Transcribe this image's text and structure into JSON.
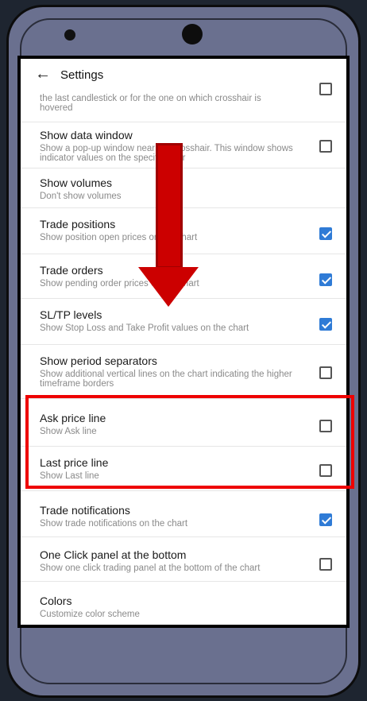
{
  "header": {
    "title": "Settings"
  },
  "colors": {
    "accent": "#2f7bd6",
    "arrow": "#cc0000",
    "highlight": "#ee0000"
  },
  "rows": [
    {
      "title": "",
      "subtitle": "the last candlestick or for the one on which crosshair is hovered",
      "checked": false
    },
    {
      "title": "Show data window",
      "subtitle": "Show a pop-up window near the crosshair. This window shows indicator values on the specified bar",
      "checked": false
    },
    {
      "title": "Show volumes",
      "subtitle": "Don't show volumes",
      "checked": null
    },
    {
      "title": "Trade positions",
      "subtitle": "Show position open prices on the chart",
      "checked": true
    },
    {
      "title": "Trade orders",
      "subtitle": "Show pending order prices on the chart",
      "checked": true
    },
    {
      "title": "SL/TP levels",
      "subtitle": "Show Stop Loss and Take Profit values on the chart",
      "checked": true
    },
    {
      "title": "Show period separators",
      "subtitle": "Show additional vertical lines on the chart indicating the higher timeframe borders",
      "checked": false
    },
    {
      "title": "Ask price line",
      "subtitle": "Show Ask line",
      "checked": false
    },
    {
      "title": "Last price line",
      "subtitle": "Show Last line",
      "checked": false
    },
    {
      "title": "Trade notifications",
      "subtitle": "Show trade notifications on the chart",
      "checked": true
    },
    {
      "title": "One Click panel at the bottom",
      "subtitle": "Show one click trading panel at the bottom of the chart",
      "checked": false
    },
    {
      "title": "Colors",
      "subtitle": "Customize color scheme",
      "checked": null
    }
  ]
}
